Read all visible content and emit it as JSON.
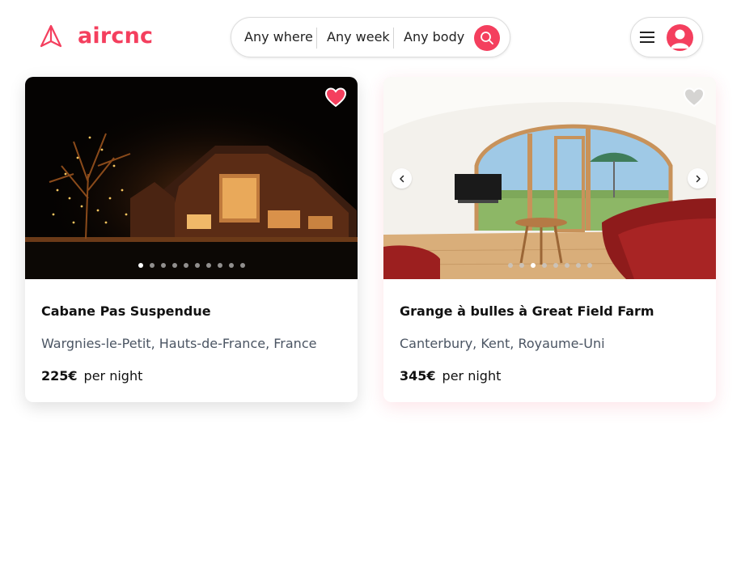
{
  "brand": {
    "name": "aircnc",
    "logo_icon": "paper-plane-icon",
    "accent": "#f43f5e"
  },
  "search": {
    "where": "Any where",
    "when": "Any week",
    "who": "Any body",
    "button_icon": "search-icon"
  },
  "user_menu": {
    "menu_icon": "hamburger-icon",
    "avatar_icon": "user-avatar-icon"
  },
  "listings": [
    {
      "title": "Cabane Pas Suspendue",
      "location": "Wargnies-le-Petit, Hauts-de-France, France",
      "price": "225€",
      "price_unit": "per night",
      "favorited": true,
      "photo_count": 10,
      "active_photo": 1
    },
    {
      "title": "Grange à bulles à Great Field Farm",
      "location": "Canterbury, Kent, Royaume-Uni",
      "price": "345€",
      "price_unit": "per night",
      "favorited": false,
      "photo_count": 8,
      "active_photo": 3
    }
  ]
}
